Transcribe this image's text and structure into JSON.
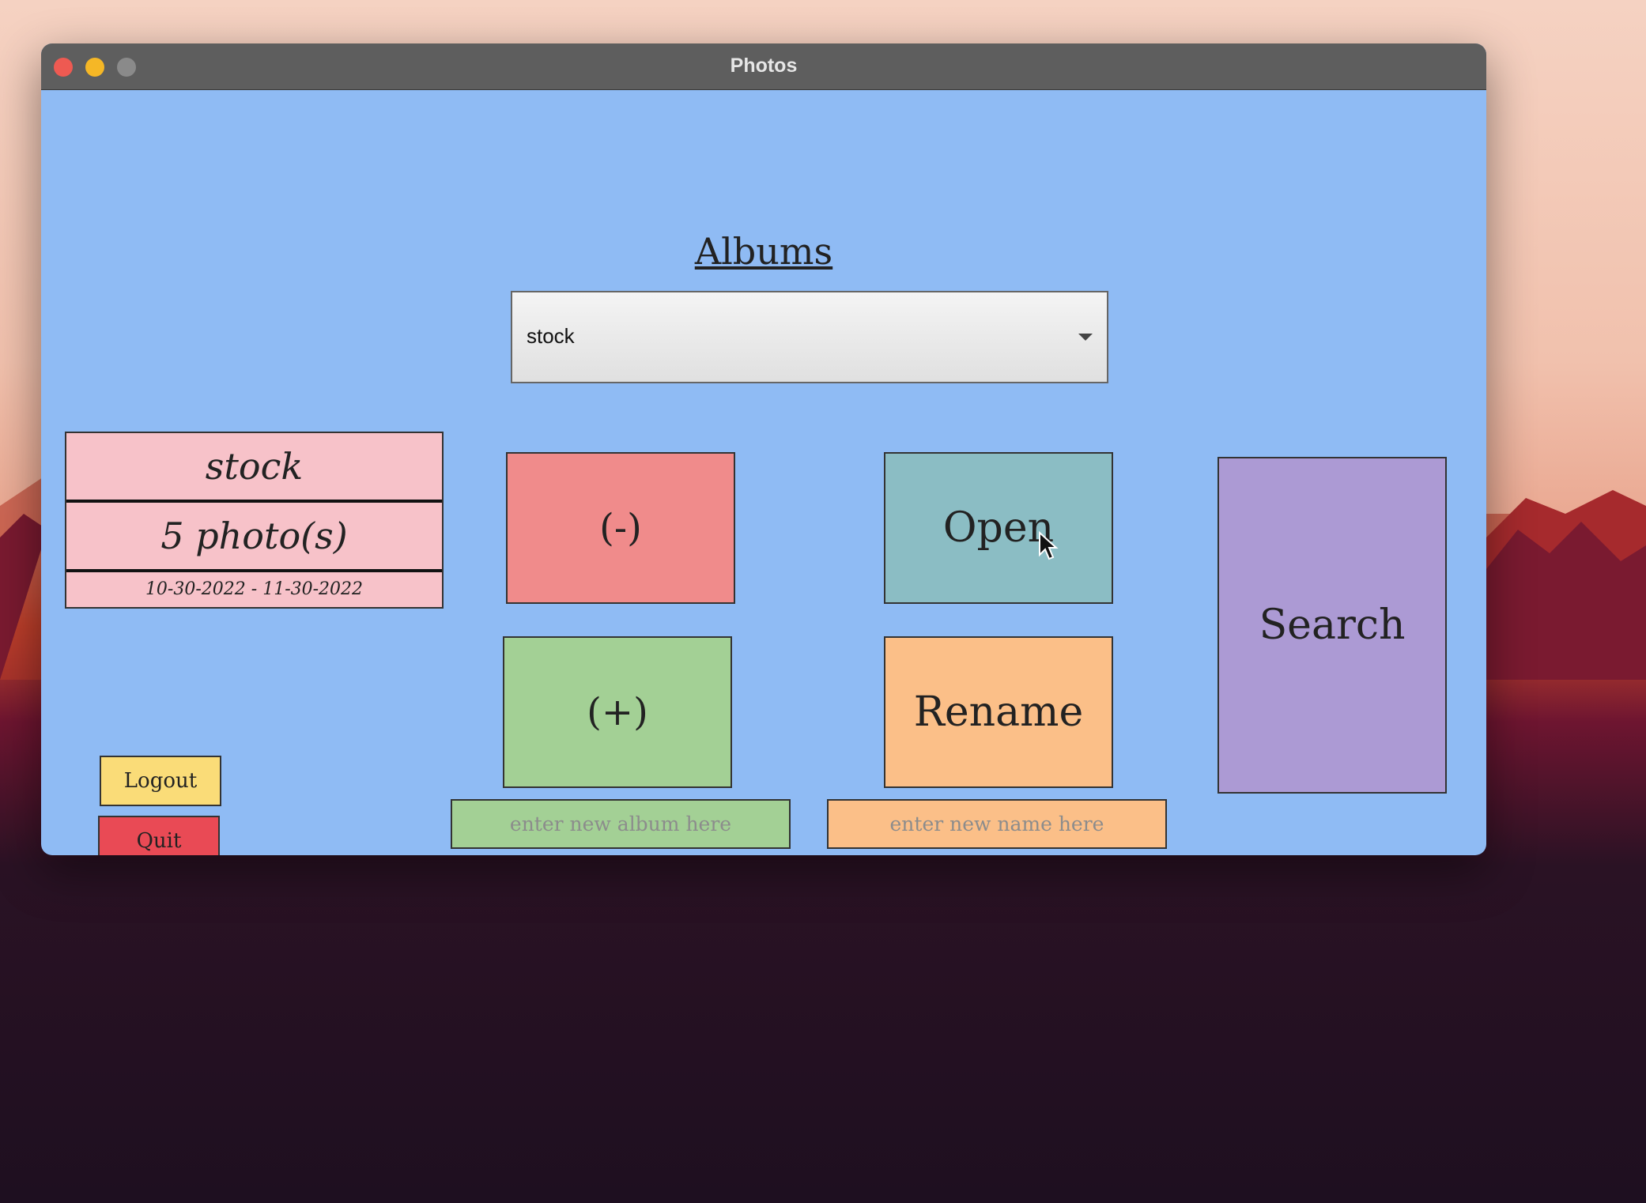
{
  "window": {
    "title": "Photos"
  },
  "albums": {
    "heading": "Albums",
    "selected": "stock"
  },
  "album_info": {
    "name": "stock",
    "photo_count": "5 photo(s)",
    "date_range": "10-30-2022 - 11-30-2022"
  },
  "buttons": {
    "delete": "(-)",
    "open": "Open",
    "search": "Search",
    "add": "(+)",
    "rename": "Rename",
    "logout": "Logout",
    "quit": "Quit"
  },
  "fields": {
    "new_album_placeholder": "enter new album here",
    "new_name_placeholder": "enter new name here"
  },
  "icons": {
    "close": "close-dot-icon",
    "minimize": "minimize-dot-icon",
    "zoom": "zoom-dot-icon",
    "dropdown": "chevron-down-icon",
    "cursor": "mouse-pointer-icon"
  }
}
